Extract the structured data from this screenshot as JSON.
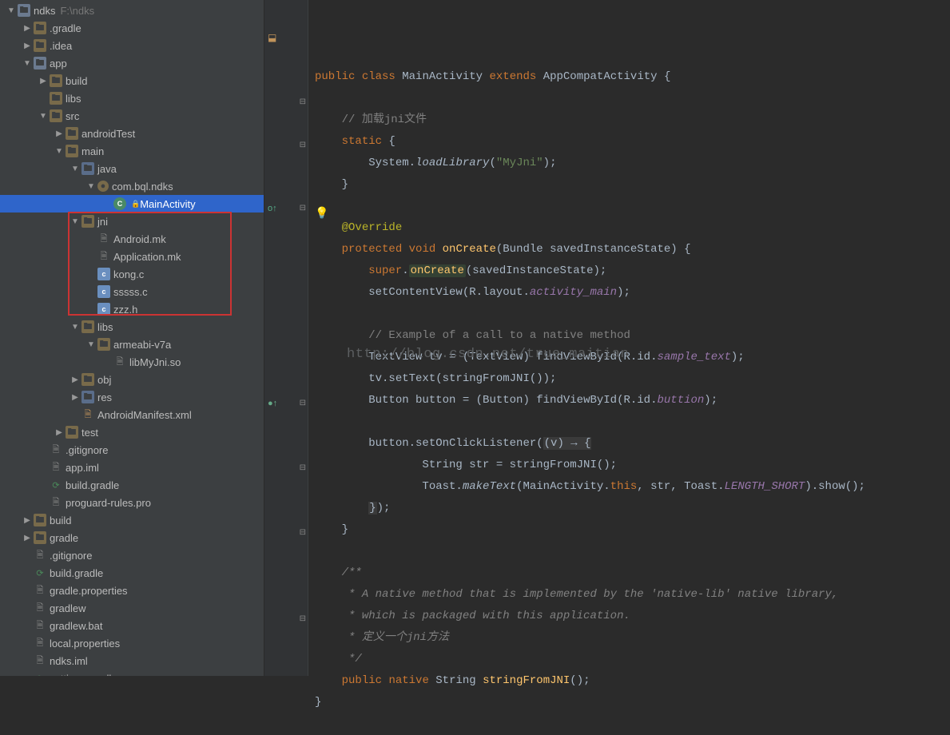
{
  "project": {
    "name": "ndks",
    "path": "F:\\ndks"
  },
  "tree": [
    {
      "l": ".gradle",
      "d": 1,
      "exp": false,
      "ic": "folder",
      "arrow": true
    },
    {
      "l": ".idea",
      "d": 1,
      "exp": false,
      "ic": "folder",
      "arrow": true
    },
    {
      "l": "app",
      "d": 1,
      "exp": true,
      "ic": "module-folder",
      "arrow": true
    },
    {
      "l": "build",
      "d": 2,
      "exp": false,
      "ic": "folder",
      "arrow": true
    },
    {
      "l": "libs",
      "d": 2,
      "exp": null,
      "ic": "folder",
      "arrow": false
    },
    {
      "l": "src",
      "d": 2,
      "exp": true,
      "ic": "folder",
      "arrow": true
    },
    {
      "l": "androidTest",
      "d": 3,
      "exp": false,
      "ic": "folder",
      "arrow": true
    },
    {
      "l": "main",
      "d": 3,
      "exp": true,
      "ic": "folder",
      "arrow": true
    },
    {
      "l": "java",
      "d": 4,
      "exp": true,
      "ic": "folder-blue",
      "arrow": true
    },
    {
      "l": "com.bql.ndks",
      "d": 5,
      "exp": true,
      "ic": "pkg",
      "arrow": true
    },
    {
      "l": "MainActivity",
      "d": 6,
      "exp": null,
      "ic": "java",
      "arrow": false,
      "selected": true,
      "lock": true
    },
    {
      "l": "jni",
      "d": 4,
      "exp": true,
      "ic": "folder",
      "arrow": true,
      "boxstart": true
    },
    {
      "l": "Android.mk",
      "d": 5,
      "exp": null,
      "ic": "file",
      "arrow": false
    },
    {
      "l": "Application.mk",
      "d": 5,
      "exp": null,
      "ic": "file",
      "arrow": false
    },
    {
      "l": "kong.c",
      "d": 5,
      "exp": null,
      "ic": "c-file",
      "arrow": false
    },
    {
      "l": "sssss.c",
      "d": 5,
      "exp": null,
      "ic": "c-file",
      "arrow": false
    },
    {
      "l": "zzz.h",
      "d": 5,
      "exp": null,
      "ic": "c-file",
      "arrow": false,
      "boxend": true
    },
    {
      "l": "libs",
      "d": 4,
      "exp": true,
      "ic": "folder",
      "arrow": true
    },
    {
      "l": "armeabi-v7a",
      "d": 5,
      "exp": true,
      "ic": "folder",
      "arrow": true
    },
    {
      "l": "libMyJni.so",
      "d": 6,
      "exp": null,
      "ic": "file",
      "arrow": false
    },
    {
      "l": "obj",
      "d": 4,
      "exp": false,
      "ic": "folder",
      "arrow": true
    },
    {
      "l": "res",
      "d": 4,
      "exp": false,
      "ic": "folder-blue",
      "arrow": true
    },
    {
      "l": "AndroidManifest.xml",
      "d": 4,
      "exp": null,
      "ic": "xml",
      "arrow": false
    },
    {
      "l": "test",
      "d": 3,
      "exp": false,
      "ic": "folder",
      "arrow": true
    },
    {
      "l": ".gitignore",
      "d": 2,
      "exp": null,
      "ic": "file",
      "arrow": false
    },
    {
      "l": "app.iml",
      "d": 2,
      "exp": null,
      "ic": "file",
      "arrow": false
    },
    {
      "l": "build.gradle",
      "d": 2,
      "exp": null,
      "ic": "gradle",
      "arrow": false
    },
    {
      "l": "proguard-rules.pro",
      "d": 2,
      "exp": null,
      "ic": "file",
      "arrow": false
    },
    {
      "l": "build",
      "d": 1,
      "exp": false,
      "ic": "folder",
      "arrow": true
    },
    {
      "l": "gradle",
      "d": 1,
      "exp": false,
      "ic": "folder",
      "arrow": true
    },
    {
      "l": ".gitignore",
      "d": 1,
      "exp": null,
      "ic": "file",
      "arrow": false
    },
    {
      "l": "build.gradle",
      "d": 1,
      "exp": null,
      "ic": "gradle",
      "arrow": false
    },
    {
      "l": "gradle.properties",
      "d": 1,
      "exp": null,
      "ic": "file",
      "arrow": false
    },
    {
      "l": "gradlew",
      "d": 1,
      "exp": null,
      "ic": "file",
      "arrow": false
    },
    {
      "l": "gradlew.bat",
      "d": 1,
      "exp": null,
      "ic": "file",
      "arrow": false
    },
    {
      "l": "local.properties",
      "d": 1,
      "exp": null,
      "ic": "file",
      "arrow": false
    },
    {
      "l": "ndks.iml",
      "d": 1,
      "exp": null,
      "ic": "file",
      "arrow": false
    },
    {
      "l": "settings.gradle",
      "d": 1,
      "exp": null,
      "ic": "gradle",
      "arrow": false
    }
  ],
  "code": {
    "classDecl": {
      "public": "public",
      "class": "class",
      "name": "MainActivity",
      "extends": "extends",
      "super": "AppCompatActivity",
      "brace": "{"
    },
    "comment1": "// 加载jni文件",
    "staticBlock": {
      "static": "static",
      "open": " {",
      "body1": "System.",
      "loadLib": "loadLibrary",
      "arg": "\"MyJni\"",
      "close": ");",
      "end": "}"
    },
    "override": "@Override",
    "onCreate": {
      "protected": "protected",
      "void": "void",
      "name": "onCreate",
      "params": "(Bundle savedInstanceState) {"
    },
    "superCall": {
      "super": "super",
      "dot": ".",
      "fn": "onCreate",
      "rest": "(savedInstanceState);"
    },
    "setContent": {
      "pre": "setContentView(R.layout.",
      "act": "activity_main",
      "post": ");"
    },
    "comment2": "// Example of a call to a native method",
    "tv": {
      "pre": "TextView tv = (TextView) findViewById(R.id.",
      "id": "sample_text",
      "post": ");"
    },
    "tvSet": "tv.setText(stringFromJNI());",
    "btn": {
      "pre": "Button button = (Button) findViewById(R.id.",
      "id": "buttion",
      "post": ");"
    },
    "listener": {
      "pre": "button.setOnClickListener(",
      "lambda": "(v) → {"
    },
    "str": "String str = stringFromJNI();",
    "toast": {
      "pre": "Toast.",
      "make": "makeText",
      "mid": "(MainActivity.",
      "this": "this",
      "c1": ", str, Toast.",
      "len": "LENGTH_SHORT",
      "post": ").show();"
    },
    "lambdaEnd": "});",
    "methodEnd": "}",
    "doc": {
      "l1": "/**",
      "l2": " * A native method that is implemented by the 'native-lib' native library,",
      "l3": " * which is packaged with this application.",
      "l4": " * 定义一个jni方法",
      "l5": " */"
    },
    "nativeDecl": {
      "public": "public",
      "native": "native",
      "type": "String ",
      "name": "stringFromJNI",
      "rest": "();"
    },
    "classEnd": "}"
  },
  "watermark": "http://blog.csdn.net/true_maitian"
}
